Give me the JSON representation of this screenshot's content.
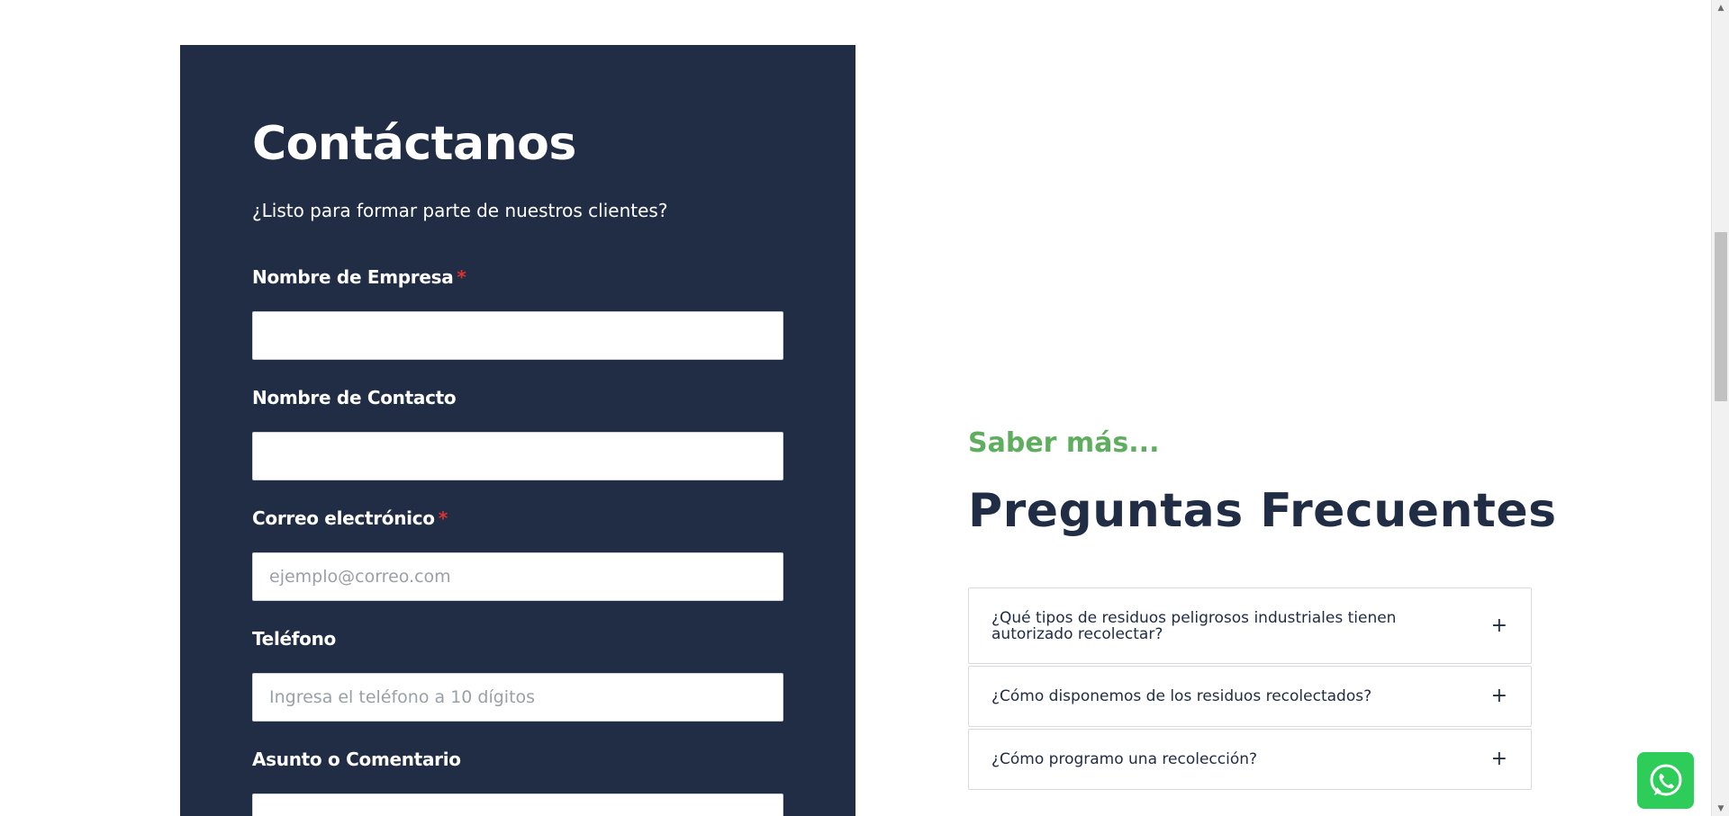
{
  "contact": {
    "title": "Contáctanos",
    "subtitle": "¿Listo para formar parte de nuestros clientes?",
    "fields": [
      {
        "label": "Nombre de Empresa",
        "required": "*",
        "placeholder": "",
        "value": ""
      },
      {
        "label": "Nombre de Contacto",
        "required": "",
        "placeholder": "",
        "value": ""
      },
      {
        "label": "Correo electrónico",
        "required": "*",
        "placeholder": "ejemplo@correo.com",
        "value": ""
      },
      {
        "label": "Teléfono",
        "required": "",
        "placeholder": "Ingresa el teléfono a 10 dígitos",
        "value": ""
      },
      {
        "label": "Asunto o Comentario",
        "required": "",
        "placeholder": "",
        "value": ""
      }
    ]
  },
  "faq": {
    "kicker": "Saber más...",
    "title": "Preguntas Frecuentes",
    "items": [
      {
        "question": "¿Qué tipos de residuos peligrosos industriales tienen autorizado recolectar?",
        "toggle": "+"
      },
      {
        "question": "¿Cómo disponemos de los residuos recolectados?",
        "toggle": "+"
      },
      {
        "question": "¿Cómo programo una recolección?",
        "toggle": "+"
      }
    ]
  },
  "icons": {
    "whatsapp": "whatsapp-icon",
    "scroll_up": "▲",
    "scroll_down": "▼"
  },
  "colors": {
    "panel": "#212d45",
    "accent_green": "#5fae5f",
    "required": "#e03131",
    "whatsapp": "#2ecc59"
  }
}
